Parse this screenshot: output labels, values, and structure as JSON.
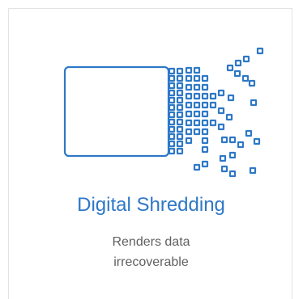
{
  "card": {
    "icon": "digital-shredding-icon",
    "title": "Digital Shredding",
    "description_line_1": "Renders data",
    "description_line_2": "irrecoverable",
    "accent_color": "#2e78c6",
    "text_color": "#606060"
  }
}
